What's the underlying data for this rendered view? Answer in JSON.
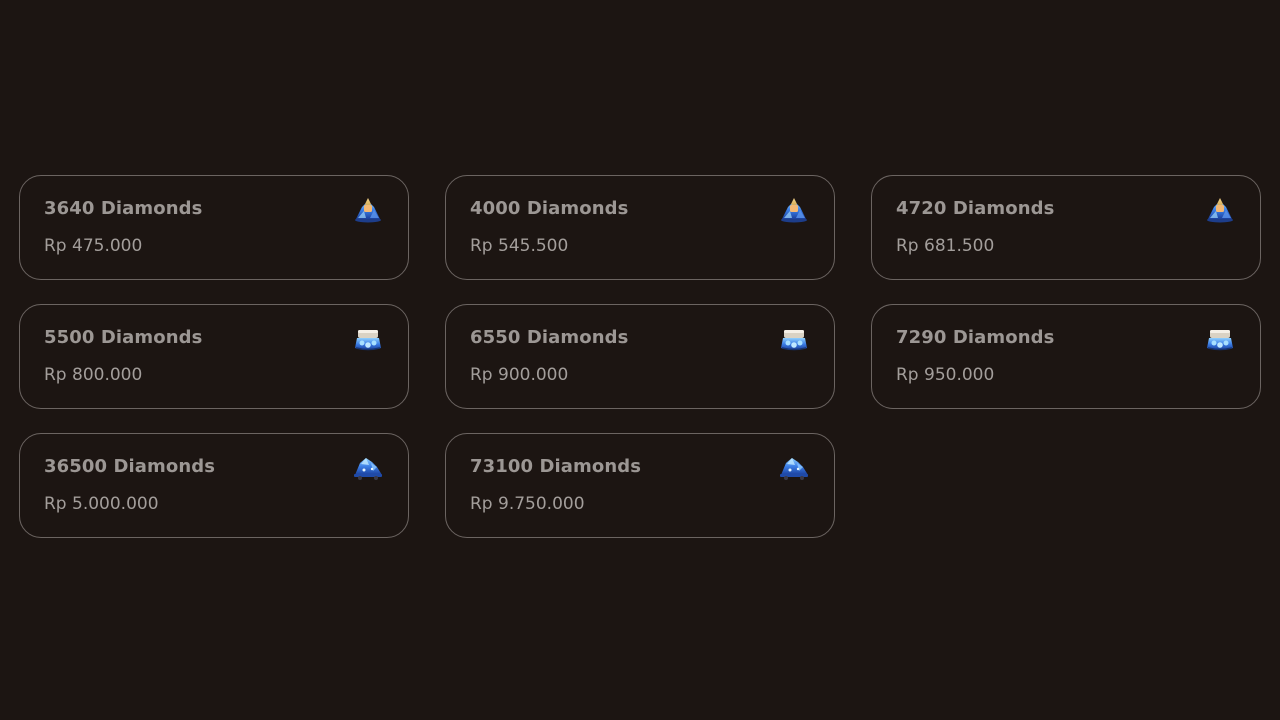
{
  "packages": [
    {
      "title": "3640 Diamonds",
      "price": "Rp 475.000",
      "icon": "diamond-pile-icon"
    },
    {
      "title": "4000 Diamonds",
      "price": "Rp 545.500",
      "icon": "diamond-pile-icon"
    },
    {
      "title": "4720 Diamonds",
      "price": "Rp 681.500",
      "icon": "diamond-pile-icon"
    },
    {
      "title": "5500 Diamonds",
      "price": "Rp 800.000",
      "icon": "diamond-chest-icon"
    },
    {
      "title": "6550 Diamonds",
      "price": "Rp 900.000",
      "icon": "diamond-chest-icon"
    },
    {
      "title": "7290 Diamonds",
      "price": "Rp 950.000",
      "icon": "diamond-chest-icon"
    },
    {
      "title": "36500 Diamonds",
      "price": "Rp 5.000.000",
      "icon": "diamond-cart-icon"
    },
    {
      "title": "73100 Diamonds",
      "price": "Rp 9.750.000",
      "icon": "diamond-cart-icon"
    }
  ],
  "colors": {
    "background": "#1c1512",
    "card_border": "#6b6461",
    "title_text": "#9c9794",
    "price_text": "#a39e9b",
    "diamond_blue": "#2f6fd8"
  }
}
